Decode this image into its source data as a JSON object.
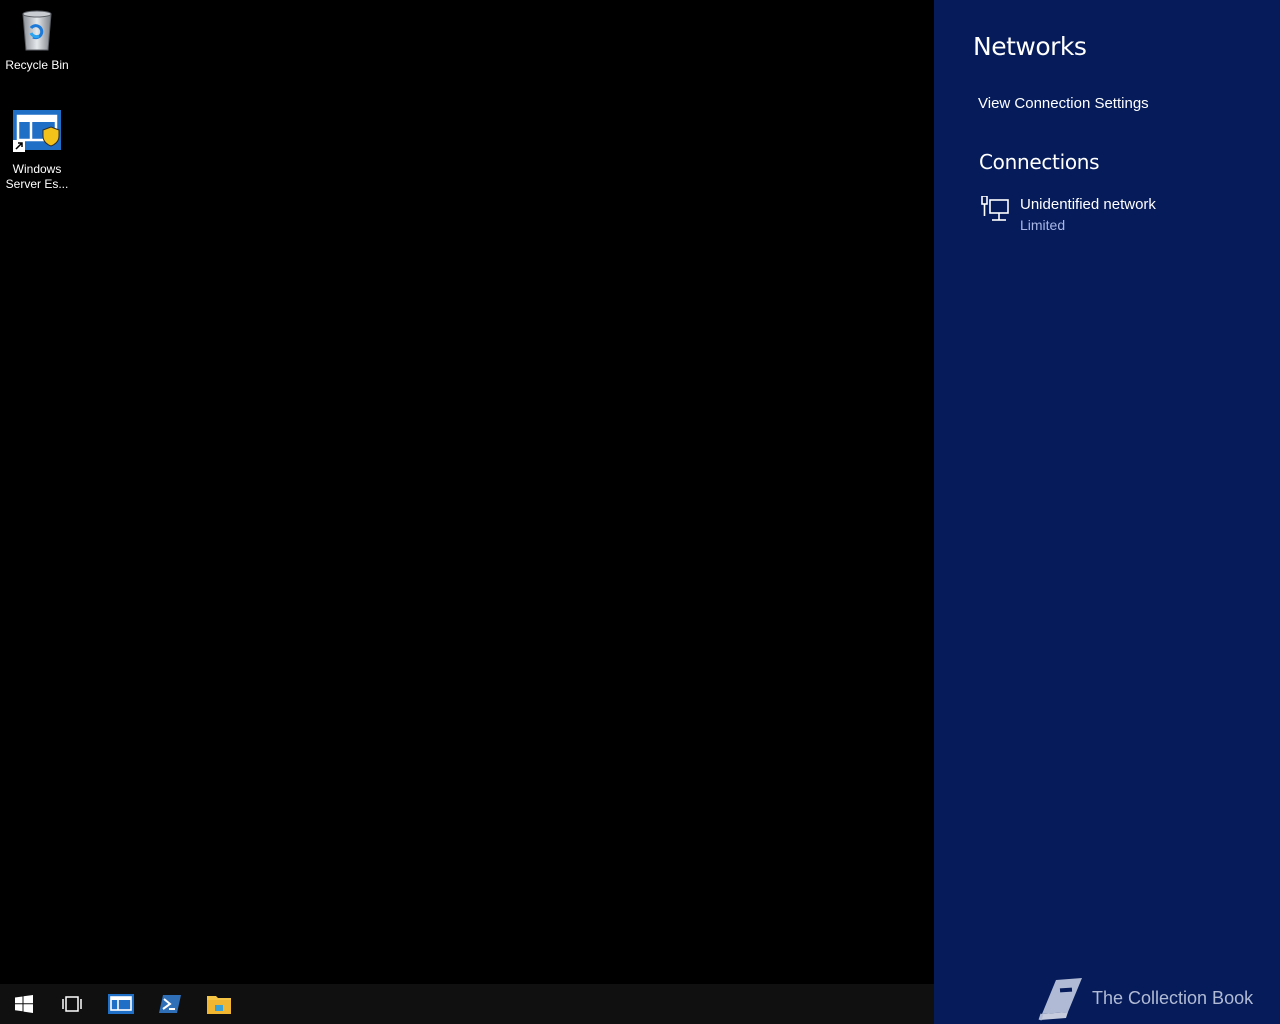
{
  "desktop": {
    "icons": [
      {
        "label": "Recycle Bin",
        "icon": "recycle-bin-icon"
      },
      {
        "label": "Windows Server Es...",
        "label_line1": "Windows",
        "label_line2": "Server Es...",
        "icon": "windows-server-essentials-dashboard-icon"
      }
    ]
  },
  "taskbar": {
    "items": [
      {
        "name": "start",
        "icon": "windows-logo-icon"
      },
      {
        "name": "task-view",
        "icon": "task-view-icon"
      },
      {
        "name": "server-essentials",
        "icon": "dashboard-icon"
      },
      {
        "name": "powershell",
        "icon": "powershell-icon"
      },
      {
        "name": "file-explorer",
        "icon": "folder-icon"
      }
    ],
    "background": "#101010"
  },
  "networks_panel": {
    "title": "Networks",
    "view_settings_label": "View Connection Settings",
    "connections_heading": "Connections",
    "connections": [
      {
        "name": "Unidentified network",
        "status": "Limited",
        "icon": "wired-network-icon"
      }
    ],
    "background": "#051b5a",
    "status_color": "#a9b7e6"
  },
  "watermark": {
    "text": "The Collection Book",
    "icon": "book-icon"
  }
}
